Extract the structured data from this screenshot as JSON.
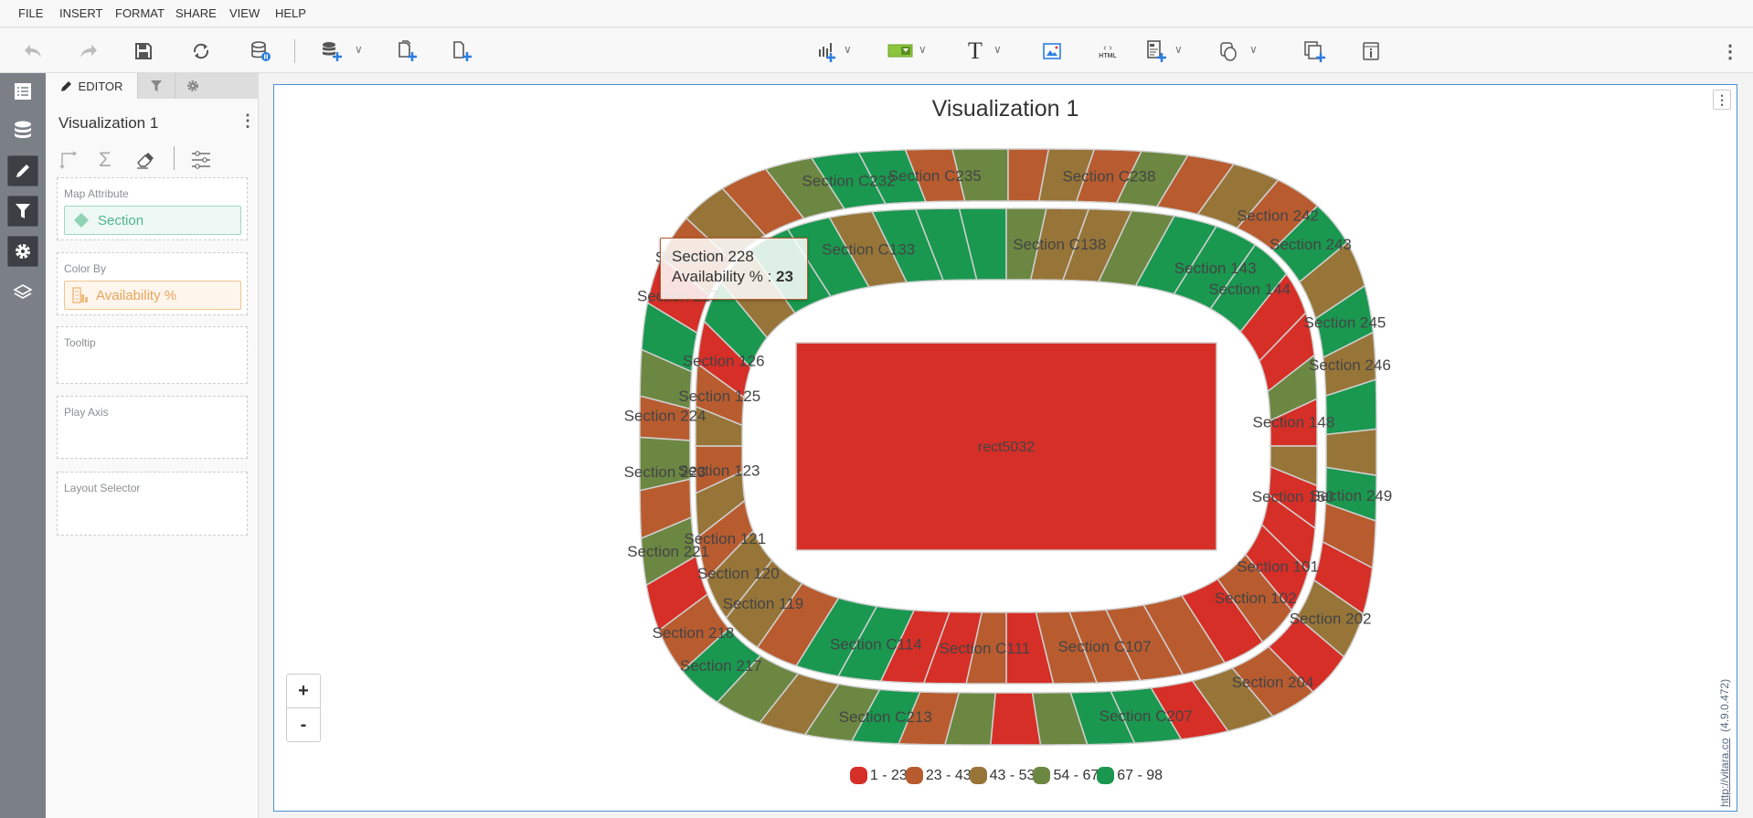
{
  "menu": [
    "FILE",
    "INSERT",
    "FORMAT",
    "SHARE",
    "VIEW",
    "HELP"
  ],
  "toolbar": {
    "left": [
      "undo-icon",
      "redo-icon",
      "save-icon",
      "refresh-icon",
      "datasource-pause-icon",
      "add-datasource-icon",
      "copy-page-add-icon",
      "new-page-icon"
    ],
    "right": [
      "add-chart-icon",
      "add-filter-widget-icon",
      "add-text-icon",
      "add-image-icon",
      "add-html-icon",
      "add-report-icon",
      "add-shape-icon",
      "duplicate-icon",
      "info-icon"
    ],
    "html_label": "HTML"
  },
  "rail": [
    "list-icon",
    "database-icon",
    "pencil-icon",
    "filter-icon",
    "gear-icon",
    "layers-icon"
  ],
  "panel": {
    "tab_editor": "EDITOR",
    "viz_name": "Visualization 1",
    "zones": {
      "map_attribute": {
        "label": "Map Attribute",
        "value": "Section"
      },
      "color_by": {
        "label": "Color By",
        "value": "Availability %"
      },
      "tooltip": {
        "label": "Tooltip"
      },
      "play_axis": {
        "label": "Play Axis"
      },
      "layout_selector": {
        "label": "Layout Selector"
      }
    }
  },
  "map": {
    "title": "Visualization 1",
    "field_label": "rect5032",
    "colors": [
      "#d62f27",
      "#b85c30",
      "#977538",
      "#6c8742",
      "#1a9850"
    ],
    "legend": [
      {
        "label": "1 - 23",
        "color": "#d62f27"
      },
      {
        "label": "23 - 43",
        "color": "#b85c30"
      },
      {
        "label": "43 - 53",
        "color": "#977538"
      },
      {
        "label": "54 - 67",
        "color": "#6c8742"
      },
      {
        "label": "67 - 98",
        "color": "#1a9850"
      }
    ],
    "upper_ring": [
      [
        "",
        0
      ],
      [
        "Section 221",
        3
      ],
      [
        "",
        1
      ],
      [
        "Section 223",
        3
      ],
      [
        "Section 224",
        1
      ],
      [
        "",
        3
      ],
      [
        "",
        4
      ],
      [
        "Section 227",
        0
      ],
      [
        "Section 228",
        1
      ],
      [
        "",
        2
      ],
      [
        "",
        1
      ],
      [
        "",
        3
      ],
      [
        "Section C232",
        4
      ],
      [
        "",
        4
      ],
      [
        "Section C235",
        1
      ],
      [
        "",
        3
      ],
      [
        "",
        1
      ],
      [
        "",
        2
      ],
      [
        "Section C238",
        1
      ],
      [
        "",
        3
      ],
      [
        "",
        1
      ],
      [
        "",
        2
      ],
      [
        "Section 242",
        1
      ],
      [
        "Section 243",
        4
      ],
      [
        "",
        2
      ],
      [
        "Section 245",
        4
      ],
      [
        "Section 246",
        2
      ],
      [
        "",
        4
      ],
      [
        "",
        2
      ],
      [
        "Section 249",
        4
      ],
      [
        "",
        1
      ],
      [
        "",
        0
      ],
      [
        "Section 202",
        2
      ],
      [
        "",
        0
      ],
      [
        "Section 204",
        1
      ],
      [
        "",
        2
      ],
      [
        "",
        0
      ],
      [
        "Section C207",
        4
      ],
      [
        "",
        4
      ],
      [
        "",
        3
      ],
      [
        "",
        0
      ],
      [
        "",
        3
      ],
      [
        "",
        1
      ],
      [
        "Section C213",
        4
      ],
      [
        "",
        3
      ],
      [
        "",
        2
      ],
      [
        "",
        3
      ],
      [
        "Section 217",
        4
      ],
      [
        "Section 218",
        1
      ]
    ],
    "lower_ring": [
      [
        "Section 120",
        2
      ],
      [
        "Section 121",
        1
      ],
      [
        "",
        2
      ],
      [
        "Section 123",
        1
      ],
      [
        "",
        2
      ],
      [
        "Section 125",
        1
      ],
      [
        "Section 126",
        0
      ],
      [
        "",
        4
      ],
      [
        "",
        2
      ],
      [
        "",
        4
      ],
      [
        "",
        4
      ],
      [
        "Section C133",
        2
      ],
      [
        "",
        4
      ],
      [
        "",
        4
      ],
      [
        "",
        4
      ],
      [
        "",
        3
      ],
      [
        "Section C138",
        2
      ],
      [
        "",
        2
      ],
      [
        "",
        3
      ],
      [
        "",
        4
      ],
      [
        "Section 143",
        4
      ],
      [
        "Section 144",
        4
      ],
      [
        "",
        0
      ],
      [
        "",
        0
      ],
      [
        "",
        3
      ],
      [
        "Section 148",
        0
      ],
      [
        "",
        2
      ],
      [
        "Section 150",
        0
      ],
      [
        "",
        0
      ],
      [
        "Section 101",
        0
      ],
      [
        "Section 102",
        1
      ],
      [
        "",
        0
      ],
      [
        "",
        1
      ],
      [
        "",
        1
      ],
      [
        "Section C107",
        1
      ],
      [
        "",
        1
      ],
      [
        "",
        0
      ],
      [
        "Section C111",
        1
      ],
      [
        "",
        0
      ],
      [
        "",
        0
      ],
      [
        "Section C114",
        4
      ],
      [
        "",
        4
      ],
      [
        "",
        1
      ],
      [
        "Section 119",
        2
      ]
    ],
    "tooltip": {
      "title": "Section 228",
      "metric": "Availability % : ",
      "value": "23"
    },
    "zoom_in": "+",
    "zoom_out": "-",
    "credit": "http://vitara.co",
    "version": "(4.9.0.472)"
  }
}
